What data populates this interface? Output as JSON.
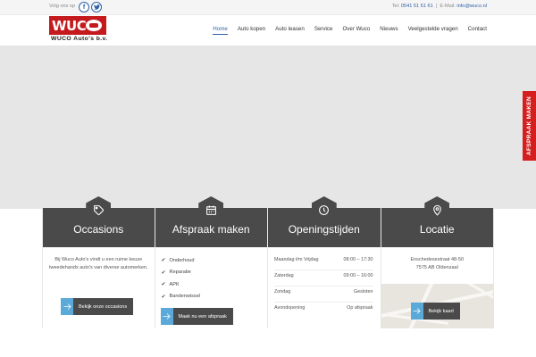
{
  "topbar": {
    "follow_label": "Volg ons op",
    "facebook_glyph": "f",
    "contact_phone_label": "Tel:",
    "contact_phone": "0541 51 51 61",
    "separator": "|",
    "contact_email_label": "E-Mail:",
    "contact_email": "info@wuco.nl"
  },
  "logo": {
    "text": "WUC",
    "subtitle": "WUCO Auto's b.v."
  },
  "nav": {
    "items": [
      {
        "label": "Home"
      },
      {
        "label": "Auto kopen"
      },
      {
        "label": "Auto leasen"
      },
      {
        "label": "Service"
      },
      {
        "label": "Over Wuco"
      },
      {
        "label": "Nieuws"
      },
      {
        "label": "Veelgestelde vragen"
      },
      {
        "label": "Contact"
      }
    ]
  },
  "side_tab": {
    "label": "AFSPRAAK MAKEN"
  },
  "panels": {
    "occasions": {
      "title": "Occasions",
      "icon": "tag-icon",
      "text": "Bij Wuco Auto's vindt u een ruime keuze tweedehands auto's van diverse automerken.",
      "button": "Bekijk onze occasions"
    },
    "afspraak": {
      "title": "Afspraak maken",
      "icon": "calendar-icon",
      "items": [
        "Onderhoud",
        "Reparatie",
        "APK",
        "Bandenwissel"
      ],
      "button": "Maak nu een afspraak"
    },
    "openingstijden": {
      "title": "Openingstijden",
      "icon": "clock-icon",
      "rows": [
        {
          "day": "Maandag t/m Vrijdag",
          "time": "08:00 – 17:30"
        },
        {
          "day": "Zaterdag",
          "time": "09:00 – 16:00"
        },
        {
          "day": "Zondag",
          "time": "Gesloten"
        },
        {
          "day": "Avondopening",
          "time": "Op afspraak"
        }
      ]
    },
    "locatie": {
      "title": "Locatie",
      "icon": "map-pin-icon",
      "address_line1": "Enschedesestraat 48-50",
      "address_line2": "7575 AB Oldenzaal",
      "button": "Bekijk kaart"
    }
  },
  "colors": {
    "brand_red": "#c41a1d",
    "accent_blue": "#2f62a8",
    "panel_dark": "#4a4a4a",
    "arrow_blue": "#5aa9d8"
  }
}
